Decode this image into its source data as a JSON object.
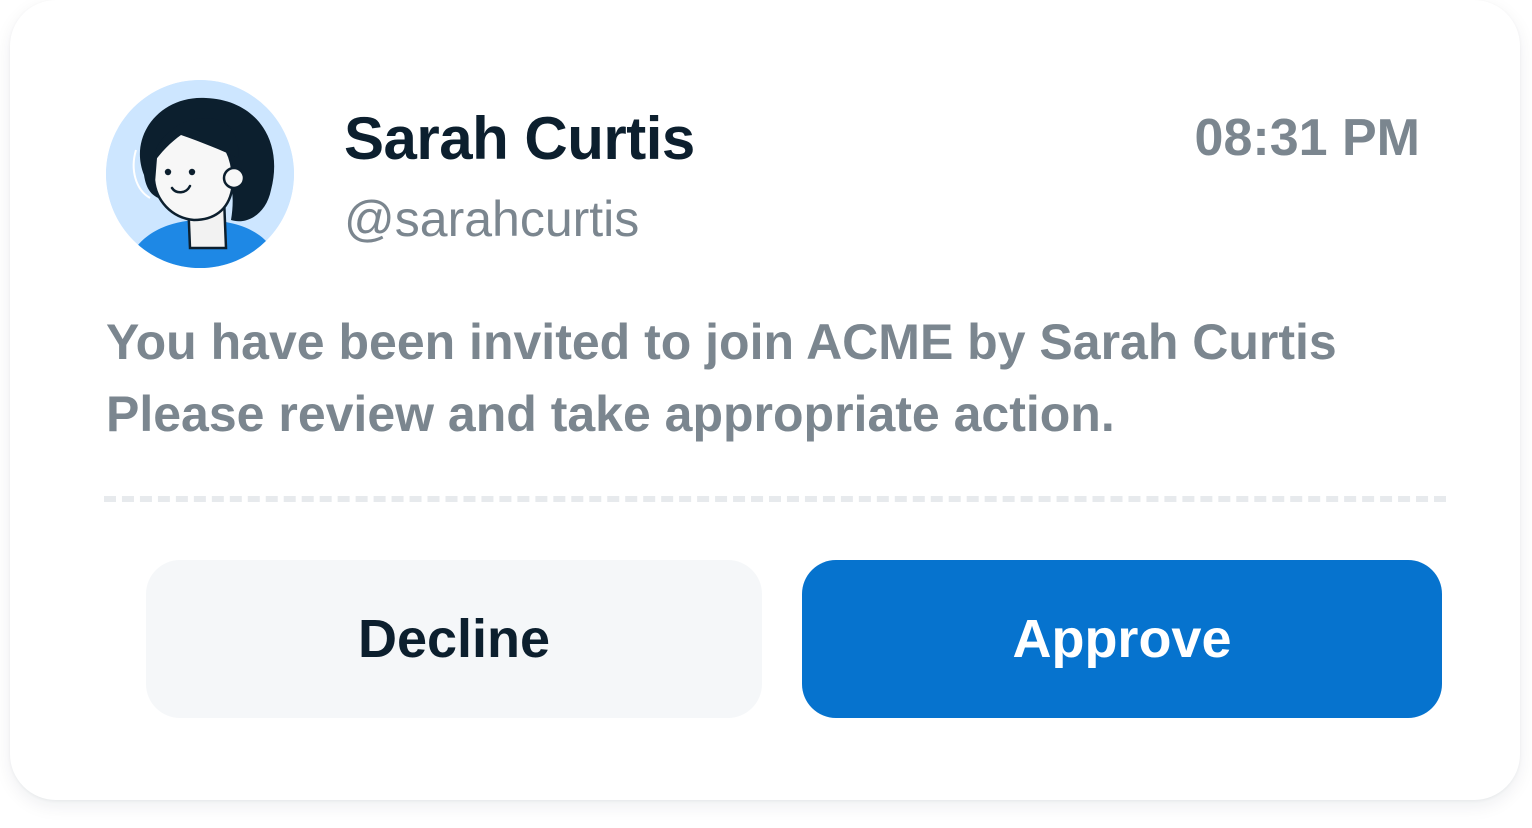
{
  "notification": {
    "sender_name": "Sarah Curtis",
    "sender_handle": "@sarahcurtis",
    "time": "08:31 PM",
    "avatar_icon": "woman-avatar-icon",
    "message_lines": [
      "You have been invited to join ACME by Sarah Curtis",
      "Please review and take appropriate action."
    ]
  },
  "actions": {
    "decline_label": "Decline",
    "approve_label": "Approve"
  },
  "colors": {
    "primary": "#0673ce",
    "secondary_button_bg": "#f5f7f9",
    "text_dark": "#0c1f2e",
    "text_muted": "#7b868f",
    "avatar_bg": "#cde6ff"
  }
}
